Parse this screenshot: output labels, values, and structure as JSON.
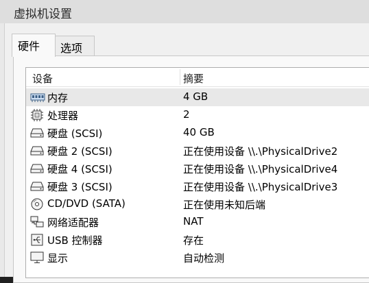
{
  "window": {
    "title": "虚拟机设置"
  },
  "tabs": [
    {
      "label": "硬件",
      "active": true
    },
    {
      "label": "选项",
      "active": false
    }
  ],
  "device_list": {
    "headers": {
      "device": "设备",
      "summary": "摘要"
    },
    "rows": [
      {
        "icon": "memory-icon",
        "device": "内存",
        "summary": "4 GB",
        "selected": true
      },
      {
        "icon": "processor-icon",
        "device": "处理器",
        "summary": "2",
        "selected": false
      },
      {
        "icon": "hard-disk-icon",
        "device": "硬盘 (SCSI)",
        "summary": "40 GB",
        "selected": false
      },
      {
        "icon": "hard-disk-icon",
        "device": "硬盘 2 (SCSI)",
        "summary": "正在使用设备 \\\\.\\PhysicalDrive2",
        "selected": false
      },
      {
        "icon": "hard-disk-icon",
        "device": "硬盘 4 (SCSI)",
        "summary": "正在使用设备 \\\\.\\PhysicalDrive4",
        "selected": false
      },
      {
        "icon": "hard-disk-icon",
        "device": "硬盘 3 (SCSI)",
        "summary": "正在使用设备 \\\\.\\PhysicalDrive3",
        "selected": false
      },
      {
        "icon": "cd-dvd-icon",
        "device": "CD/DVD (SATA)",
        "summary": "正在使用未知后端",
        "selected": false
      },
      {
        "icon": "network-adapter-icon",
        "device": "网络适配器",
        "summary": "NAT",
        "selected": false
      },
      {
        "icon": "usb-icon",
        "device": "USB 控制器",
        "summary": "存在",
        "selected": false
      },
      {
        "icon": "display-icon",
        "device": "显示",
        "summary": "自动检测",
        "selected": false
      }
    ]
  }
}
